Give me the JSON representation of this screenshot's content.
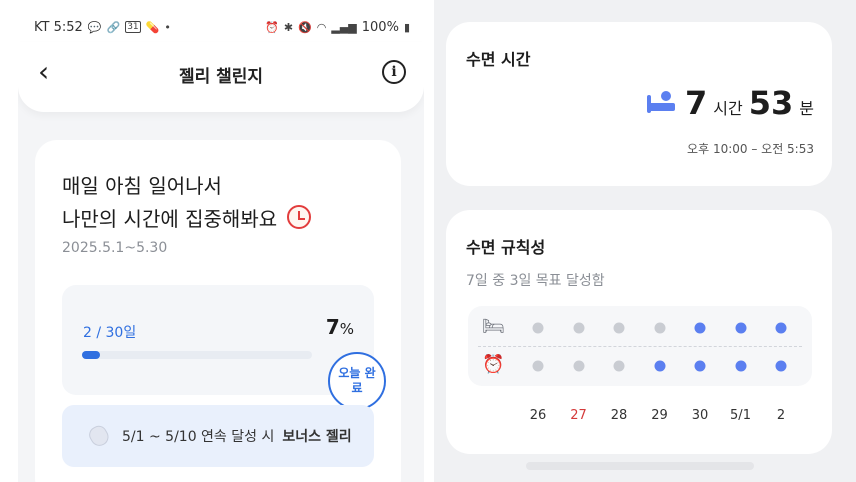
{
  "status_bar": {
    "carrier_time": "KT 5:52",
    "battery": "100%",
    "calendar_badge": "31"
  },
  "left_header": {
    "title": "젤리 챌린지",
    "back_icon": "chevron-left-icon",
    "info_icon": "info-icon"
  },
  "challenge": {
    "headline_line1": "매일 아침 일어나서",
    "headline_line2": "나만의 시간에 집중해봐요",
    "period": "2025.5.1~5.30",
    "days": "2 / 30일",
    "percent": "7",
    "percent_unit": "%",
    "progress_fraction": 0.07,
    "today_badge": "오늘 완료",
    "bonus_text": "5/1 ~ 5/10 연속 달성 시",
    "bonus_reward": "보너스 젤리"
  },
  "sleep_time": {
    "title": "수면 시간",
    "hours": "7",
    "hours_unit": "시간",
    "minutes": "53",
    "minutes_unit": "분",
    "range": "오후 10:00 – 오전 5:53"
  },
  "sleep_regularity": {
    "title": "수면 규칙성",
    "goal_text": "7일 중 3일 목표 달성함",
    "days": [
      "26",
      "27",
      "28",
      "29",
      "30",
      "5/1",
      "2"
    ],
    "highlight_day_index": 1,
    "bedtime_on": [
      false,
      false,
      false,
      false,
      true,
      true,
      true
    ],
    "wake_on": [
      false,
      false,
      false,
      true,
      true,
      true,
      true
    ],
    "accent_color": "#5b7ff0",
    "inactive_color": "#c9ccd2"
  }
}
